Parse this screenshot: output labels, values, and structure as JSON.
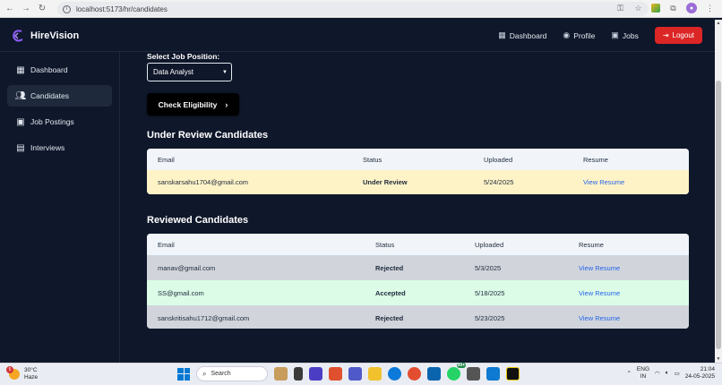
{
  "browser": {
    "url": "localhost:5173/hr/candidates",
    "back_icon": "arrow-left-icon",
    "forward_icon": "arrow-right-icon",
    "reload_icon": "reload-icon"
  },
  "header": {
    "brand": "HireVision",
    "links": [
      {
        "label": "Dashboard",
        "icon": "grid-icon"
      },
      {
        "label": "Profile",
        "icon": "user-circle-icon"
      },
      {
        "label": "Jobs",
        "icon": "briefcase-icon"
      }
    ],
    "logout": "Logout",
    "logout_color": "#dc2626"
  },
  "sidebar": {
    "items": [
      {
        "label": "Dashboard",
        "icon": "grid-icon"
      },
      {
        "label": "Candidates",
        "icon": "users-icon",
        "active": true
      },
      {
        "label": "Job Postings",
        "icon": "briefcase-icon"
      },
      {
        "label": "Interviews",
        "icon": "calendar-icon"
      }
    ]
  },
  "main": {
    "select_label": "Select Job Position:",
    "selected_job": "Data Analyst",
    "check_button": "Check Eligibility",
    "under_review": {
      "title": "Under Review Candidates",
      "headers": [
        "Email",
        "Status",
        "Uploaded",
        "Resume"
      ],
      "rows": [
        {
          "email": "sanskarsahu1704@gmail.com",
          "status": "Under Review",
          "uploaded": "5/24/2025",
          "resume": "View Resume"
        }
      ]
    },
    "reviewed": {
      "title": "Reviewed Candidates",
      "headers": [
        "Email",
        "Status",
        "Uploaded",
        "Resume"
      ],
      "rows": [
        {
          "email": "manav@gmail.com",
          "status": "Rejected",
          "uploaded": "5/3/2025",
          "resume": "View Resume"
        },
        {
          "email": "SS@gmail.com",
          "status": "Accepted",
          "uploaded": "5/18/2025",
          "resume": "View Resume"
        },
        {
          "email": "sanskritisahu1712@gmail.com",
          "status": "Rejected",
          "uploaded": "5/23/2025",
          "resume": "View Resume"
        }
      ]
    }
  },
  "taskbar": {
    "weather_temp": "30°C",
    "weather_desc": "Haze",
    "weather_badge": "5",
    "search_placeholder": "Search",
    "lang_line1": "ENG",
    "lang_line2": "IN",
    "time": "21:04",
    "date": "24-05-2025",
    "notification_badge": "99+"
  }
}
